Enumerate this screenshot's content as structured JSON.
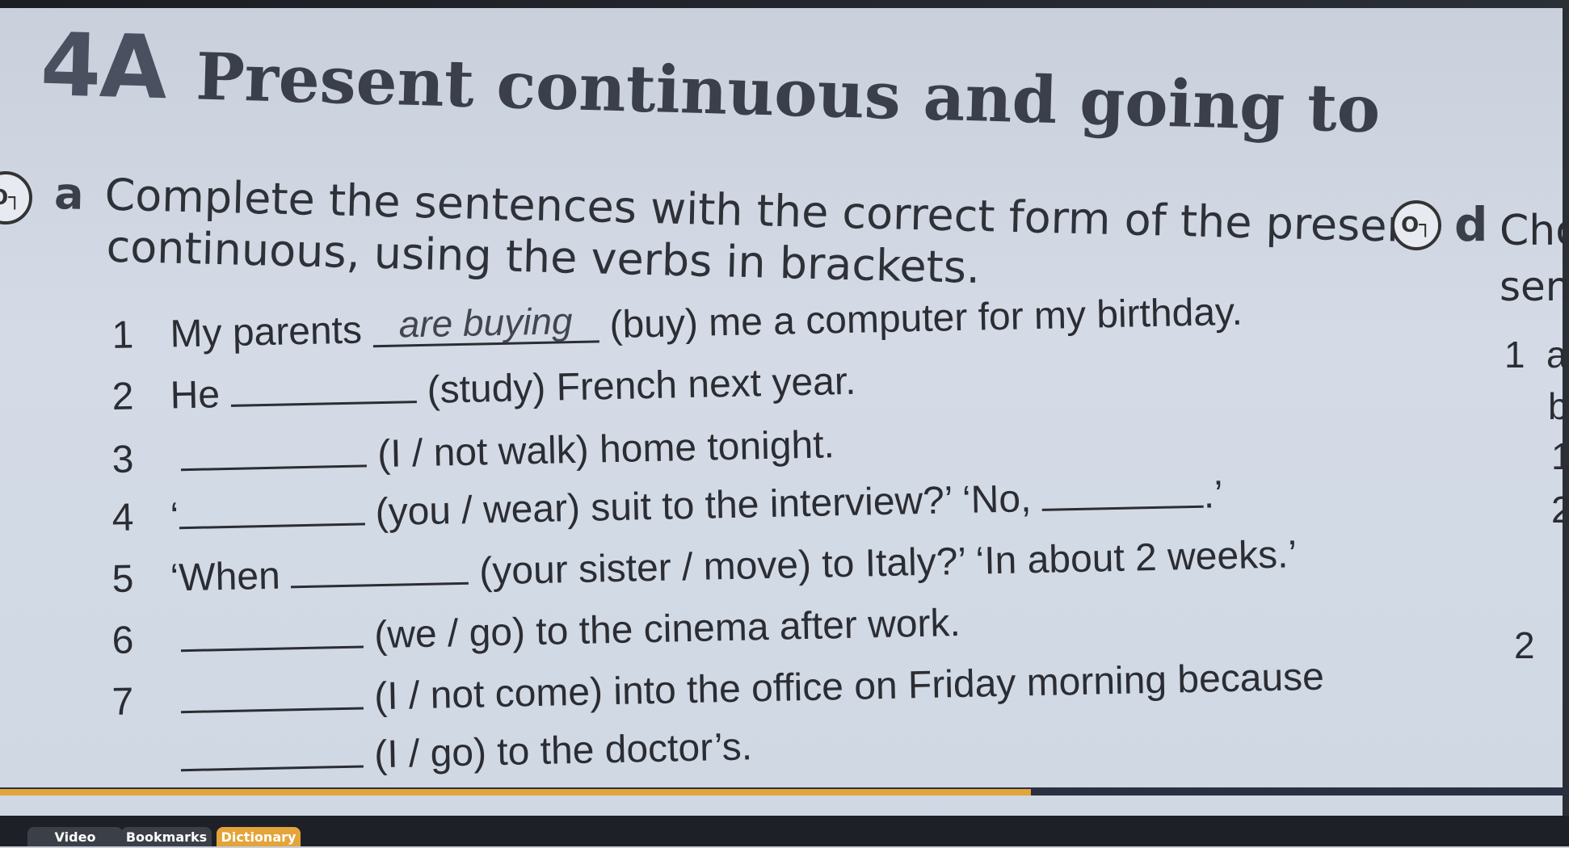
{
  "heading": {
    "number": "4A",
    "title": "Present continuous and going to"
  },
  "exercise_a": {
    "key_icon": "key-icon",
    "letter": "a",
    "instruction_line1": "Complete the sentences with the correct form of the present",
    "instruction_line2": "continuous, using the verbs in brackets."
  },
  "sentences": [
    {
      "num": "1",
      "before": "My parents",
      "answer": "are buying",
      "after": "(buy) me a computer for my birthday."
    },
    {
      "num": "2",
      "before": "He",
      "answer": "",
      "after": "(study) French next year."
    },
    {
      "num": "3",
      "before": "",
      "answer": "",
      "after": "(I / not walk) home tonight."
    },
    {
      "num": "4",
      "before": "‘",
      "answer": "",
      "after": "(you / wear) suit to the interview?’ ‘No,",
      "after2": ".’"
    },
    {
      "num": "5",
      "before": "‘When",
      "answer": "",
      "after": "(your sister / move) to Italy?’ ‘In about 2 weeks.’"
    },
    {
      "num": "6",
      "before": "",
      "answer": "",
      "after": "(we / go) to the cinema after work."
    },
    {
      "num": "7",
      "before": "",
      "answer": "",
      "after": "(I / not come) into the office on Friday morning because"
    },
    {
      "num": "",
      "before": "",
      "answer": "",
      "after": "(I / go) to the doctor’s."
    }
  ],
  "exercise_d": {
    "letter": "d",
    "text1": "Cho",
    "text2": "sent",
    "items": [
      "1",
      "a",
      "b",
      "1",
      "2",
      "2"
    ]
  },
  "tabs": [
    "Video",
    "Bookmarks",
    "Dictionary"
  ],
  "colors": {
    "progress": "#e3a43a",
    "tab_active": "#e3a43a",
    "tab_inactive": "#3b3f48"
  }
}
